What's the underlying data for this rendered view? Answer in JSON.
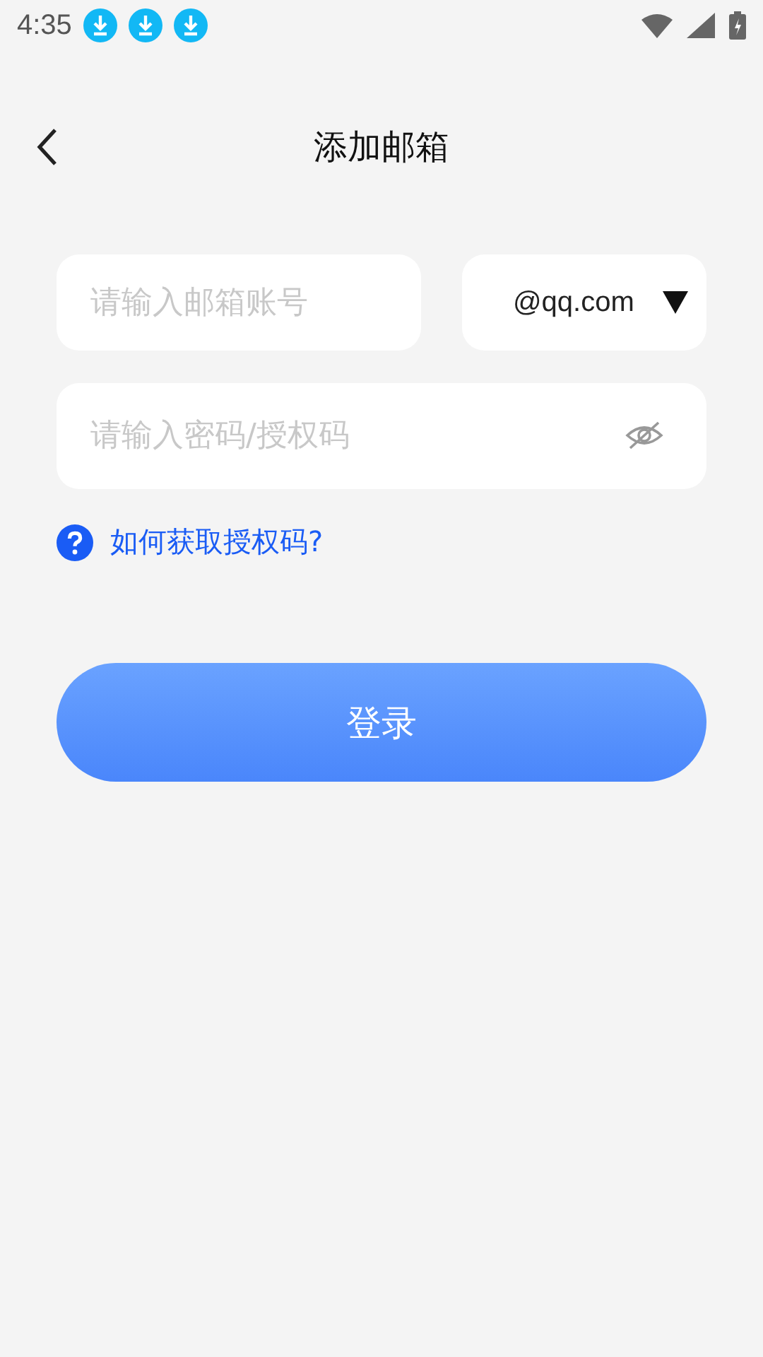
{
  "status_bar": {
    "time": "4:35",
    "notifications": [
      {
        "kind": "download"
      },
      {
        "kind": "download"
      },
      {
        "kind": "download"
      }
    ]
  },
  "header": {
    "title": "添加邮箱"
  },
  "account": {
    "placeholder": "请输入邮箱账号",
    "domain": "@qq.com"
  },
  "password": {
    "placeholder": "请输入密码/授权码"
  },
  "help_link": "如何获取授权码?",
  "login_button": "登录"
}
